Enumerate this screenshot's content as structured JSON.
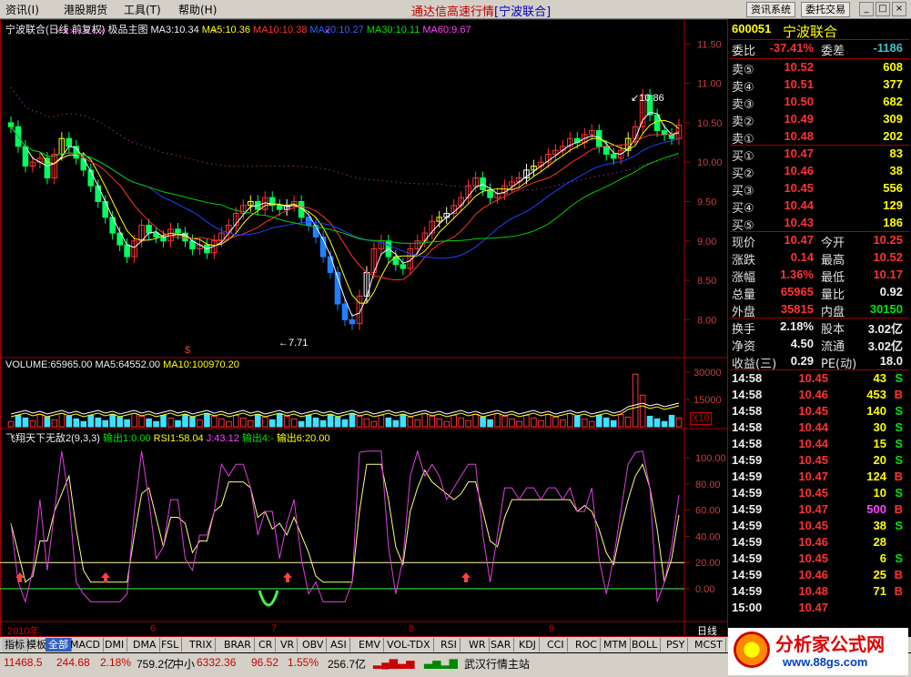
{
  "menu": [
    {
      "label": "资讯(I)"
    },
    {
      "label": "港股期货"
    },
    {
      "label": "工具(T)"
    },
    {
      "label": "帮助(H)"
    }
  ],
  "title": {
    "main": "通达信高速行情",
    "sub": "[宁波联合]"
  },
  "window_buttons": {
    "info": "资讯系统",
    "trade": "委托交易"
  },
  "chart_header": {
    "name": "宁波联合(日线 前复权) 极品主图",
    "ma3": "MA3:10.34",
    "ma5": "MA5:10.36",
    "ma10": "MA10:10.38",
    "ma20": "MA20:10.27",
    "ma30": "MA30:10.11",
    "ma60": "MA60:9.67"
  },
  "volume_header": {
    "vol": "VOLUME:65965.00",
    "ma5": "MA5:64552.00",
    "ma10": "MA10:100970.20"
  },
  "indicator_header": {
    "name": "飞翔天下无敌2(9,3,3)",
    "o1": "输出1:0.00",
    "rsi": "RSI1:58.04",
    "j": "J:43.12",
    "o4": "输出4:-",
    "o6": "输出6:20.00"
  },
  "annotations": {
    "high": "10.86",
    "low": "7.71",
    "mark": "$"
  },
  "x_axis": [
    "2010年",
    "6",
    "7",
    "8",
    "9"
  ],
  "period_label": "日线",
  "vol_scale": "X10",
  "chart_data": {
    "type": "candlestick",
    "price_axis": {
      "ticks": [
        11.5,
        11.0,
        10.5,
        10.0,
        9.5,
        9.0,
        8.5,
        8.0
      ]
    },
    "volume_axis": {
      "ticks": [
        30000,
        15000
      ]
    },
    "indicator_axis": {
      "ticks": [
        100.0,
        80.0,
        60.0,
        40.0,
        20.0,
        0.0
      ]
    },
    "closes": [
      10.45,
      10.2,
      9.95,
      10.0,
      10.05,
      9.8,
      10.1,
      10.3,
      10.2,
      10.05,
      9.9,
      9.7,
      9.5,
      9.3,
      9.1,
      8.95,
      8.8,
      9.0,
      9.2,
      9.1,
      9.05,
      9.0,
      9.15,
      9.1,
      9.0,
      8.9,
      8.95,
      8.85,
      9.0,
      9.1,
      9.2,
      9.35,
      9.45,
      9.5,
      9.4,
      9.55,
      9.45,
      9.4,
      9.45,
      9.5,
      9.3,
      9.2,
      9.05,
      8.8,
      8.6,
      8.2,
      8.0,
      7.95,
      8.3,
      8.6,
      8.9,
      9.0,
      8.8,
      8.7,
      8.65,
      8.9,
      9.0,
      9.1,
      9.25,
      9.3,
      9.35,
      9.45,
      9.55,
      9.7,
      9.8,
      9.65,
      9.55,
      9.6,
      9.7,
      9.75,
      9.8,
      9.9,
      9.95,
      10.0,
      10.1,
      10.15,
      10.2,
      10.3,
      10.25,
      10.35,
      10.4,
      10.2,
      10.1,
      10.05,
      10.15,
      10.3,
      10.45,
      10.85,
      10.6,
      10.4,
      10.35,
      10.3,
      10.47
    ]
  },
  "side": {
    "code": "600051",
    "name": "宁波联合",
    "wb": {
      "label": "委比",
      "val": "-37.41%",
      "label2": "委差",
      "val2": "-1186"
    },
    "sell": [
      {
        "l": "卖⑤",
        "p": "10.52",
        "v": "608"
      },
      {
        "l": "卖④",
        "p": "10.51",
        "v": "377"
      },
      {
        "l": "卖③",
        "p": "10.50",
        "v": "682"
      },
      {
        "l": "卖②",
        "p": "10.49",
        "v": "309"
      },
      {
        "l": "卖①",
        "p": "10.48",
        "v": "202"
      }
    ],
    "buy": [
      {
        "l": "买①",
        "p": "10.47",
        "v": "83"
      },
      {
        "l": "买②",
        "p": "10.46",
        "v": "38"
      },
      {
        "l": "买③",
        "p": "10.45",
        "v": "556"
      },
      {
        "l": "买④",
        "p": "10.44",
        "v": "129"
      },
      {
        "l": "买⑤",
        "p": "10.43",
        "v": "186"
      }
    ],
    "stats": [
      {
        "l": "现价",
        "v": "10.47",
        "l2": "今开",
        "v2": "10.25"
      },
      {
        "l": "涨跌",
        "v": "0.14",
        "l2": "最高",
        "v2": "10.52"
      },
      {
        "l": "涨幅",
        "v": "1.36%",
        "l2": "最低",
        "v2": "10.17"
      },
      {
        "l": "总量",
        "v": "65965",
        "l2": "量比",
        "v2": "0.92"
      },
      {
        "l": "外盘",
        "v": "35815",
        "l2": "内盘",
        "v2": "30150"
      }
    ],
    "stats2": [
      {
        "l": "换手",
        "v": "2.18%",
        "l2": "股本",
        "v2": "3.02亿"
      },
      {
        "l": "净资",
        "v": "4.50",
        "l2": "流通",
        "v2": "3.02亿"
      },
      {
        "l": "收益(三)",
        "v": "0.29",
        "l2": "PE(动)",
        "v2": "18.0"
      }
    ],
    "ticks": [
      {
        "t": "14:58",
        "p": "10.45",
        "v": "43",
        "s": "S"
      },
      {
        "t": "14:58",
        "p": "10.46",
        "v": "453",
        "s": "B"
      },
      {
        "t": "14:58",
        "p": "10.45",
        "v": "140",
        "s": "S"
      },
      {
        "t": "14:58",
        "p": "10.44",
        "v": "30",
        "s": "S"
      },
      {
        "t": "14:58",
        "p": "10.44",
        "v": "15",
        "s": "S"
      },
      {
        "t": "14:59",
        "p": "10.45",
        "v": "20",
        "s": "S"
      },
      {
        "t": "14:59",
        "p": "10.47",
        "v": "124",
        "s": "B"
      },
      {
        "t": "14:59",
        "p": "10.45",
        "v": "10",
        "s": "S"
      },
      {
        "t": "14:59",
        "p": "10.47",
        "v": "500",
        "s": "B"
      },
      {
        "t": "14:59",
        "p": "10.45",
        "v": "38",
        "s": "S"
      },
      {
        "t": "14:59",
        "p": "10.46",
        "v": "28",
        "s": ""
      },
      {
        "t": "14:59",
        "p": "10.45",
        "v": "6",
        "s": "S"
      },
      {
        "t": "14:59",
        "p": "10.46",
        "v": "25",
        "s": "B"
      },
      {
        "t": "14:59",
        "p": "10.48",
        "v": "71",
        "s": "B"
      },
      {
        "t": "15:00",
        "p": "10.47",
        "v": "",
        "s": ""
      }
    ]
  },
  "tabs": [
    "指标",
    "模板",
    "全部",
    "MACD",
    "DMI",
    "DMA",
    "FSL",
    "TRIX",
    "BRAR",
    "CR",
    "VR",
    "OBV",
    "ASI",
    "EMV",
    "VOL-TDX",
    "RSI",
    "WR",
    "SAR",
    "KDJ",
    "CCI",
    "ROC",
    "MTM",
    "BOLL",
    "PSY",
    "MCST"
  ],
  "status": {
    "idx1": "11468.5",
    "chg1": "244.68",
    "pct1": "2.18%",
    "amt1": "759.2亿",
    "name2": "中小",
    "idx2": "6332.36",
    "chg2": "96.52",
    "pct2": "1.55%",
    "amt2": "256.7亿",
    "site": "武汉行情主站"
  },
  "watermark": {
    "title": "分析家公式网",
    "url": "www.88gs.com"
  }
}
